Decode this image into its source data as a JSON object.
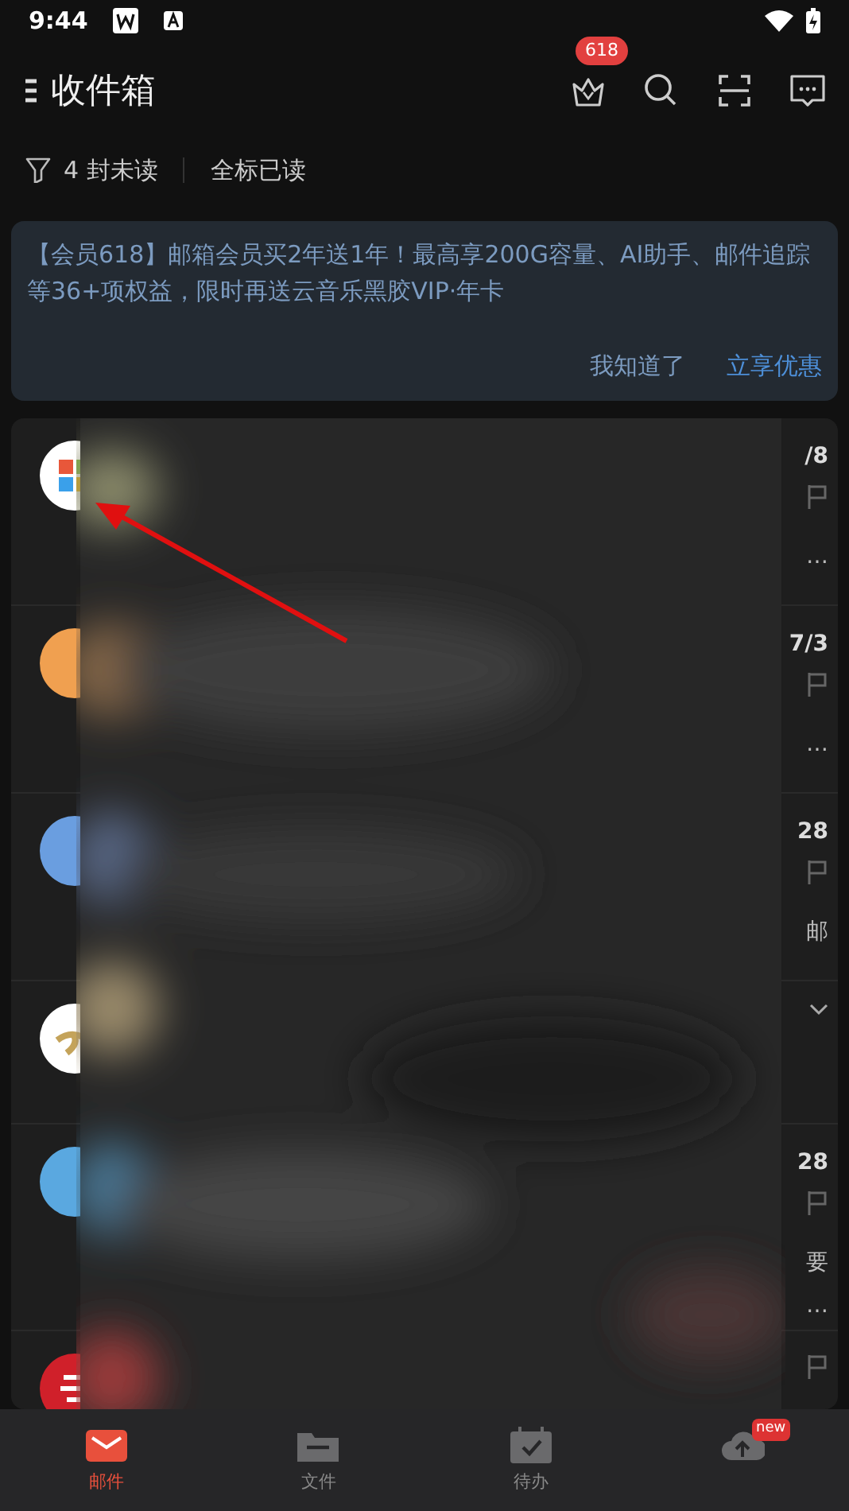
{
  "status_bar": {
    "time": "9:44"
  },
  "header": {
    "title": "收件箱",
    "vip_badge": "618"
  },
  "filter_bar": {
    "unread": "4 封未读",
    "mark_all": "全标已读"
  },
  "banner": {
    "text": "【会员618】邮箱会员买2年送1年！最高享200G容量、AI助手、邮件追踪等36+项权益，限时再送云音乐黑胶VIP·年卡",
    "buttons": [
      {
        "label": "我知道了",
        "kind": "dismiss"
      },
      {
        "label": "立享优惠",
        "kind": "primary"
      }
    ]
  },
  "mail_list": {
    "rows": [
      {
        "kind": "tiles",
        "color": "#ffffff",
        "date": "/8",
        "flagged": false,
        "snippet": "…"
      },
      {
        "kind": "plain",
        "color": "#f0a050",
        "date": "7/3",
        "flagged": false,
        "snippet": "…"
      },
      {
        "kind": "plain",
        "color": "#6a9ee0",
        "date": "28",
        "flagged": false,
        "snippet": "邮"
      },
      {
        "kind": "emblem",
        "color": "#ffffff",
        "expandable": true
      },
      {
        "kind": "plain",
        "color": "#5aa8e0",
        "date": "28",
        "flagged": false,
        "snippet": "要",
        "snippet2": "…"
      },
      {
        "kind": "emblem-red",
        "color": "#d0202a",
        "flagged": false
      }
    ]
  },
  "bottom_nav": [
    {
      "label": "邮件",
      "selected": true
    },
    {
      "label": "文件",
      "selected": false
    },
    {
      "label": "待办",
      "selected": false
    },
    {
      "badge": "new",
      "selected": false
    }
  ]
}
